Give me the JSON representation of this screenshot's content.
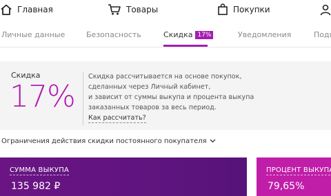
{
  "topnav": {
    "home_label": "Главная",
    "products_label": "Товары",
    "purchases_label": "Покупки",
    "icons": [
      "home-icon",
      "cart-icon",
      "bag-icon",
      "person-icon"
    ]
  },
  "tabs": [
    {
      "label": "Личные данные",
      "active": false
    },
    {
      "label": "Безопасность",
      "active": false
    },
    {
      "label": "Скидка",
      "active": true,
      "badge": "17%"
    },
    {
      "label": "Уведомления",
      "active": false
    },
    {
      "label": "Подп",
      "active": false
    }
  ],
  "discount": {
    "label": "Скидка",
    "value": "17%",
    "desc_lines": [
      "Скидка рассчитывается на основе покупок,",
      "сделанных через Личный кабинет,",
      "и зависит от суммы выкупа и процента выкупа",
      "заказанных товаров за весь период."
    ],
    "link": "Как рассчитать?"
  },
  "limits_label": "Ограничения действия скидки постоянного покупателя",
  "sum_card": {
    "title": "СУММА ВЫКУПА",
    "value": "135 982 ₽"
  },
  "pct_card": {
    "title": "ПРОЦЕНТ ВЫКУПА",
    "value": "79,65%"
  },
  "colors": {
    "accent": "#a21fb1",
    "sum_card": "#5f1480",
    "pct_card": "#c01ea8"
  }
}
